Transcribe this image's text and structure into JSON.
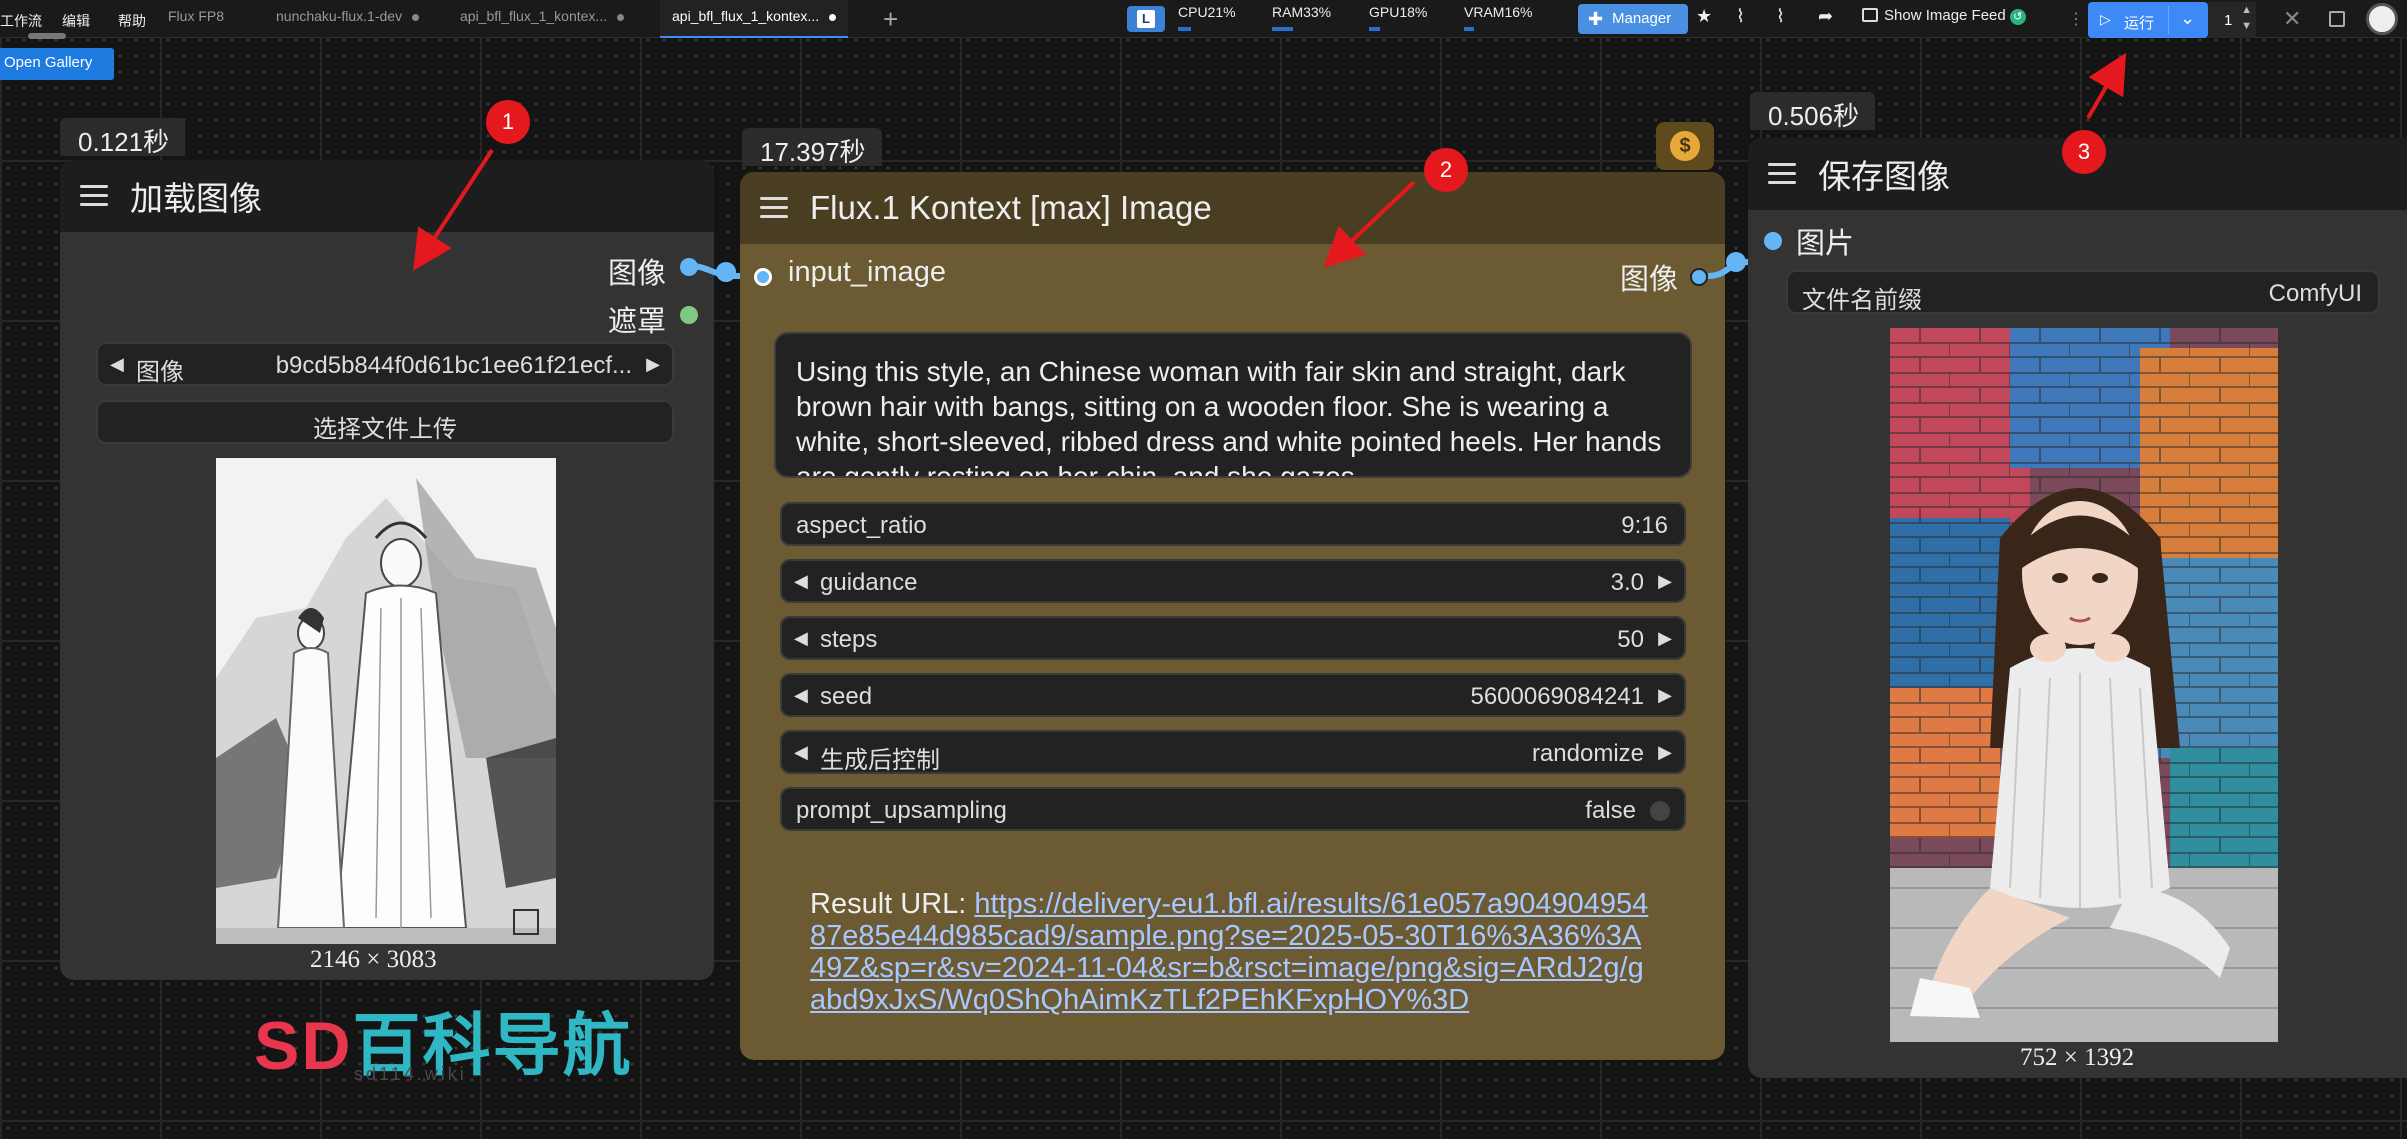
{
  "menu": [
    "工作流",
    "编辑",
    "帮助"
  ],
  "tabs": [
    {
      "label": "Flux FP8",
      "modified": false
    },
    {
      "label": "nunchaku-flux.1-dev",
      "modified": true
    },
    {
      "label": "api_bfl_flux_1_kontex...",
      "modified": true
    },
    {
      "label": "api_bfl_flux_1_kontex...",
      "modified": true,
      "active": true
    }
  ],
  "logo_letter": "L",
  "stats": [
    {
      "label": "CPU21%",
      "value": 0.21
    },
    {
      "label": "RAM33%",
      "value": 0.33
    },
    {
      "label": "GPU18%",
      "value": 0.18
    },
    {
      "label": "VRAM16%",
      "value": 0.16
    }
  ],
  "toolbar": {
    "manager_label": "Manager",
    "show_feed_label": "Show Image Feed",
    "run_label": "运行",
    "run_count": "1"
  },
  "open_gallery_label": "Open Gallery",
  "nodes": {
    "load": {
      "timing": "0.121秒",
      "title": "加载图像",
      "output_image": "图像",
      "output_mask": "遮罩",
      "image_widget_label": "图像",
      "image_widget_value": "b9cd5b844f0d61bc1ee61f21ecf...",
      "upload_label": "选择文件上传",
      "image_size": "2146 × 3083"
    },
    "flux": {
      "timing": "17.397秒",
      "title": "Flux.1 Kontext [max] Image",
      "input_label": "input_image",
      "output_label": "图像",
      "prompt": "Using this style, an Chinese woman with fair skin and straight, dark brown hair with bangs, sitting on a wooden floor. She is wearing a white, short-sleeved, ribbed dress and white pointed heels. Her hands are gently resting on her chin, and she gazes",
      "widgets": [
        {
          "label": "aspect_ratio",
          "value": "9:16",
          "arrows": false
        },
        {
          "label": "guidance",
          "value": "3.0",
          "arrows": true
        },
        {
          "label": "steps",
          "value": "50",
          "arrows": true
        },
        {
          "label": "seed",
          "value": "5600069084241",
          "arrows": true
        },
        {
          "label": "生成后控制",
          "value": "randomize",
          "arrows": true
        },
        {
          "label": "prompt_upsampling",
          "value": "false",
          "arrows": false,
          "toggle": true
        }
      ],
      "result_prefix": "Result URL: ",
      "result_url": "https://delivery-eu1.bfl.ai/results/61e057a90490495487e85e44d985cad9/sample.png?se=2025-05-30T16%3A36%3A49Z&sp=r&sv=2024-11-04&sr=b&rsct=image/png&sig=ARdJ2g/gabd9xJxS/Wq0ShQhAimKzTLf2PEhKFxpHOY%3D"
    },
    "save": {
      "timing": "0.506秒",
      "title": "保存图像",
      "input_label": "图片",
      "prefix_label": "文件名前缀",
      "prefix_value": "ComfyUI",
      "image_size": "752 × 1392"
    }
  },
  "annotations": [
    "1",
    "2",
    "3"
  ],
  "watermark": {
    "latin": "SD",
    "cn": "百科导航",
    "sub": "sd114.wiki"
  },
  "colors": {
    "accent": "#3d8af7",
    "flux_node": "#6b5a32",
    "annotation_red": "#e5191d",
    "port_image": "#64b5f6",
    "port_mask": "#81c784"
  }
}
